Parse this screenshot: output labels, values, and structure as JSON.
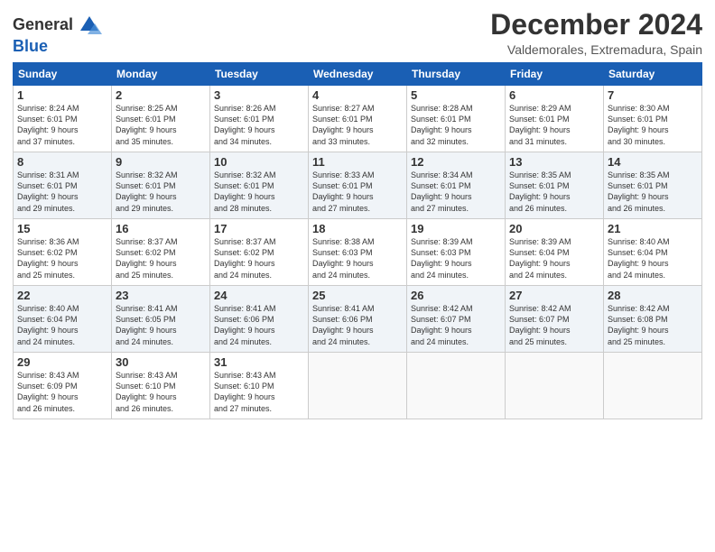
{
  "logo": {
    "line1": "General",
    "line2": "Blue"
  },
  "title": "December 2024",
  "location": "Valdemorales, Extremadura, Spain",
  "headers": [
    "Sunday",
    "Monday",
    "Tuesday",
    "Wednesday",
    "Thursday",
    "Friday",
    "Saturday"
  ],
  "weeks": [
    [
      {
        "day": "1",
        "info": "Sunrise: 8:24 AM\nSunset: 6:01 PM\nDaylight: 9 hours\nand 37 minutes."
      },
      {
        "day": "2",
        "info": "Sunrise: 8:25 AM\nSunset: 6:01 PM\nDaylight: 9 hours\nand 35 minutes."
      },
      {
        "day": "3",
        "info": "Sunrise: 8:26 AM\nSunset: 6:01 PM\nDaylight: 9 hours\nand 34 minutes."
      },
      {
        "day": "4",
        "info": "Sunrise: 8:27 AM\nSunset: 6:01 PM\nDaylight: 9 hours\nand 33 minutes."
      },
      {
        "day": "5",
        "info": "Sunrise: 8:28 AM\nSunset: 6:01 PM\nDaylight: 9 hours\nand 32 minutes."
      },
      {
        "day": "6",
        "info": "Sunrise: 8:29 AM\nSunset: 6:01 PM\nDaylight: 9 hours\nand 31 minutes."
      },
      {
        "day": "7",
        "info": "Sunrise: 8:30 AM\nSunset: 6:01 PM\nDaylight: 9 hours\nand 30 minutes."
      }
    ],
    [
      {
        "day": "8",
        "info": "Sunrise: 8:31 AM\nSunset: 6:01 PM\nDaylight: 9 hours\nand 29 minutes."
      },
      {
        "day": "9",
        "info": "Sunrise: 8:32 AM\nSunset: 6:01 PM\nDaylight: 9 hours\nand 29 minutes."
      },
      {
        "day": "10",
        "info": "Sunrise: 8:32 AM\nSunset: 6:01 PM\nDaylight: 9 hours\nand 28 minutes."
      },
      {
        "day": "11",
        "info": "Sunrise: 8:33 AM\nSunset: 6:01 PM\nDaylight: 9 hours\nand 27 minutes."
      },
      {
        "day": "12",
        "info": "Sunrise: 8:34 AM\nSunset: 6:01 PM\nDaylight: 9 hours\nand 27 minutes."
      },
      {
        "day": "13",
        "info": "Sunrise: 8:35 AM\nSunset: 6:01 PM\nDaylight: 9 hours\nand 26 minutes."
      },
      {
        "day": "14",
        "info": "Sunrise: 8:35 AM\nSunset: 6:01 PM\nDaylight: 9 hours\nand 26 minutes."
      }
    ],
    [
      {
        "day": "15",
        "info": "Sunrise: 8:36 AM\nSunset: 6:02 PM\nDaylight: 9 hours\nand 25 minutes."
      },
      {
        "day": "16",
        "info": "Sunrise: 8:37 AM\nSunset: 6:02 PM\nDaylight: 9 hours\nand 25 minutes."
      },
      {
        "day": "17",
        "info": "Sunrise: 8:37 AM\nSunset: 6:02 PM\nDaylight: 9 hours\nand 24 minutes."
      },
      {
        "day": "18",
        "info": "Sunrise: 8:38 AM\nSunset: 6:03 PM\nDaylight: 9 hours\nand 24 minutes."
      },
      {
        "day": "19",
        "info": "Sunrise: 8:39 AM\nSunset: 6:03 PM\nDaylight: 9 hours\nand 24 minutes."
      },
      {
        "day": "20",
        "info": "Sunrise: 8:39 AM\nSunset: 6:04 PM\nDaylight: 9 hours\nand 24 minutes."
      },
      {
        "day": "21",
        "info": "Sunrise: 8:40 AM\nSunset: 6:04 PM\nDaylight: 9 hours\nand 24 minutes."
      }
    ],
    [
      {
        "day": "22",
        "info": "Sunrise: 8:40 AM\nSunset: 6:04 PM\nDaylight: 9 hours\nand 24 minutes."
      },
      {
        "day": "23",
        "info": "Sunrise: 8:41 AM\nSunset: 6:05 PM\nDaylight: 9 hours\nand 24 minutes."
      },
      {
        "day": "24",
        "info": "Sunrise: 8:41 AM\nSunset: 6:06 PM\nDaylight: 9 hours\nand 24 minutes."
      },
      {
        "day": "25",
        "info": "Sunrise: 8:41 AM\nSunset: 6:06 PM\nDaylight: 9 hours\nand 24 minutes."
      },
      {
        "day": "26",
        "info": "Sunrise: 8:42 AM\nSunset: 6:07 PM\nDaylight: 9 hours\nand 24 minutes."
      },
      {
        "day": "27",
        "info": "Sunrise: 8:42 AM\nSunset: 6:07 PM\nDaylight: 9 hours\nand 25 minutes."
      },
      {
        "day": "28",
        "info": "Sunrise: 8:42 AM\nSunset: 6:08 PM\nDaylight: 9 hours\nand 25 minutes."
      }
    ],
    [
      {
        "day": "29",
        "info": "Sunrise: 8:43 AM\nSunset: 6:09 PM\nDaylight: 9 hours\nand 26 minutes."
      },
      {
        "day": "30",
        "info": "Sunrise: 8:43 AM\nSunset: 6:10 PM\nDaylight: 9 hours\nand 26 minutes."
      },
      {
        "day": "31",
        "info": "Sunrise: 8:43 AM\nSunset: 6:10 PM\nDaylight: 9 hours\nand 27 minutes."
      },
      {
        "day": "",
        "info": ""
      },
      {
        "day": "",
        "info": ""
      },
      {
        "day": "",
        "info": ""
      },
      {
        "day": "",
        "info": ""
      }
    ]
  ]
}
